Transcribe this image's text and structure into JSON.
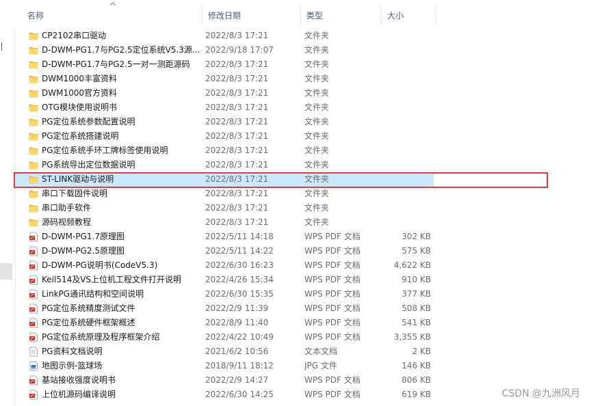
{
  "columns": {
    "name": "名称",
    "modified": "修改日期",
    "type": "类型",
    "size": "大小"
  },
  "files": [
    {
      "icon": "folder-icon",
      "name": "CP2102串口驱动",
      "modified": "2022/8/3 17:21",
      "type": "文件夹",
      "size": ""
    },
    {
      "icon": "folder-icon",
      "name": "D-DWM-PG1.7与PG2.5定位系统V5.3源...",
      "modified": "2022/9/18 17:07",
      "type": "文件夹",
      "size": ""
    },
    {
      "icon": "folder-icon",
      "name": "D-DWM-PG1.7与PG2.5一对一测距源码",
      "modified": "2022/8/3 17:21",
      "type": "文件夹",
      "size": ""
    },
    {
      "icon": "folder-icon",
      "name": "DWM1000丰富资料",
      "modified": "2022/8/3 17:21",
      "type": "文件夹",
      "size": ""
    },
    {
      "icon": "folder-icon",
      "name": "DWM1000官方资料",
      "modified": "2022/8/3 17:21",
      "type": "文件夹",
      "size": ""
    },
    {
      "icon": "folder-icon",
      "name": "OTG模块使用说明书",
      "modified": "2022/8/3 17:21",
      "type": "文件夹",
      "size": ""
    },
    {
      "icon": "folder-icon",
      "name": "PG定位系统参数配置说明",
      "modified": "2022/8/3 17:21",
      "type": "文件夹",
      "size": ""
    },
    {
      "icon": "folder-icon",
      "name": "PG定位系统搭建说明",
      "modified": "2022/8/3 17:21",
      "type": "文件夹",
      "size": ""
    },
    {
      "icon": "folder-icon",
      "name": "PG定位系统手环工牌标签使用说明",
      "modified": "2022/8/3 17:21",
      "type": "文件夹",
      "size": ""
    },
    {
      "icon": "folder-icon",
      "name": "PG系统导出定位数据说明",
      "modified": "2022/8/3 17:21",
      "type": "文件夹",
      "size": ""
    },
    {
      "icon": "folder-icon",
      "name": "ST-LINK驱动与说明",
      "modified": "2022/8/3 17:21",
      "type": "文件夹",
      "size": "",
      "selected": true
    },
    {
      "icon": "folder-icon",
      "name": "串口下载固件说明",
      "modified": "2022/8/3 17:21",
      "type": "文件夹",
      "size": ""
    },
    {
      "icon": "folder-icon",
      "name": "串口助手软件",
      "modified": "2022/8/3 17:21",
      "type": "文件夹",
      "size": ""
    },
    {
      "icon": "folder-icon",
      "name": "源码视频教程",
      "modified": "2022/8/3 17:21",
      "type": "文件夹",
      "size": ""
    },
    {
      "icon": "pdf-icon",
      "name": "D-DWM-PG1.7原理图",
      "modified": "2022/5/11 14:18",
      "type": "WPS PDF 文档",
      "size": "302 KB"
    },
    {
      "icon": "pdf-icon",
      "name": "D-DWM-PG2.5原理图",
      "modified": "2022/5/11 14:22",
      "type": "WPS PDF 文档",
      "size": "575 KB"
    },
    {
      "icon": "pdf-icon",
      "name": "D-DWM-PG说明书(CodeV5.3)",
      "modified": "2022/6/30 16:23",
      "type": "WPS PDF 文档",
      "size": "4,622 KB"
    },
    {
      "icon": "pdf-icon",
      "name": "Keil514及VS上位机工程文件打开说明",
      "modified": "2022/4/26 15:34",
      "type": "WPS PDF 文档",
      "size": "910 KB"
    },
    {
      "icon": "pdf-icon",
      "name": "LinkPG通讯结构和空间说明",
      "modified": "2022/6/30 15:35",
      "type": "WPS PDF 文档",
      "size": "377 KB"
    },
    {
      "icon": "pdf-icon",
      "name": "PG定位系统精度测试文件",
      "modified": "2022/2/9 11:39",
      "type": "WPS PDF 文档",
      "size": "508 KB"
    },
    {
      "icon": "pdf-icon",
      "name": "PG定位系统硬件框架概述",
      "modified": "2022/8/9 11:40",
      "type": "WPS PDF 文档",
      "size": "541 KB"
    },
    {
      "icon": "pdf-icon",
      "name": "PG定位系统原理及程序框架介绍",
      "modified": "2022/4/22 10:49",
      "type": "WPS PDF 文档",
      "size": "3,355 KB"
    },
    {
      "icon": "text-file-icon",
      "name": "PG资料文档说明",
      "modified": "2021/6/2 10:56",
      "type": "文本文档",
      "size": "2 KB"
    },
    {
      "icon": "image-file-icon",
      "name": "地图示例-篮球场",
      "modified": "2018/9/11 18:12",
      "type": "JPG 文件",
      "size": "146 KB"
    },
    {
      "icon": "pdf-icon",
      "name": "基站接收强度说明书",
      "modified": "2022/2/9 14:27",
      "type": "WPS PDF 文档",
      "size": "806 KB"
    },
    {
      "icon": "pdf-icon",
      "name": "上位机源码编译说明",
      "modified": "2022/6/30 14:25",
      "type": "WPS PDF 文档",
      "size": "619 KB"
    }
  ],
  "watermark": "CSDN @九洲风月",
  "colors": {
    "selection": "#cce8ff",
    "highlight_border": "#e53935",
    "folder": "#f3c44e",
    "pdf": "#d9302c"
  }
}
